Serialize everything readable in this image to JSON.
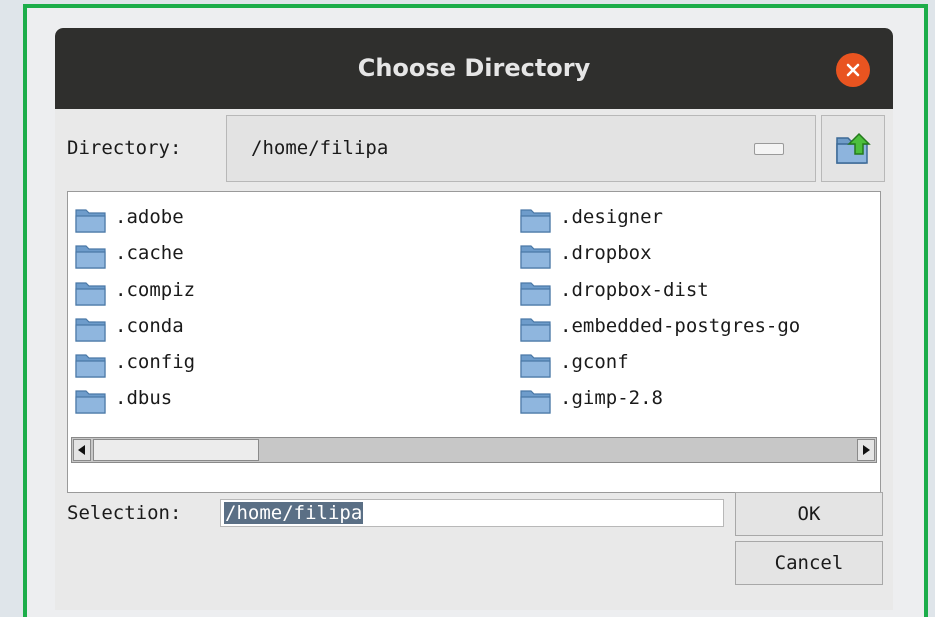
{
  "dialog": {
    "title": "Choose Directory"
  },
  "directory": {
    "label": "Directory:",
    "value": "/home/filipa"
  },
  "folders_left": [
    ".adobe",
    ".cache",
    ".compiz",
    ".conda",
    ".config",
    ".dbus"
  ],
  "folders_right": [
    ".designer",
    ".dropbox",
    ".dropbox-dist",
    ".embedded-postgres-go",
    ".gconf",
    ".gimp-2.8"
  ],
  "selection": {
    "label": "Selection:",
    "value": "/home/filipa"
  },
  "buttons": {
    "ok": "OK",
    "cancel": "Cancel"
  },
  "colors": {
    "frame_border": "#1cad4a",
    "titlebar": "#2f2f2d",
    "close_button": "#e95420",
    "selection_highlight": "#5a6f85"
  },
  "icons": {
    "close": "close-icon",
    "up": "folder-up-icon",
    "folder": "folder-icon"
  }
}
